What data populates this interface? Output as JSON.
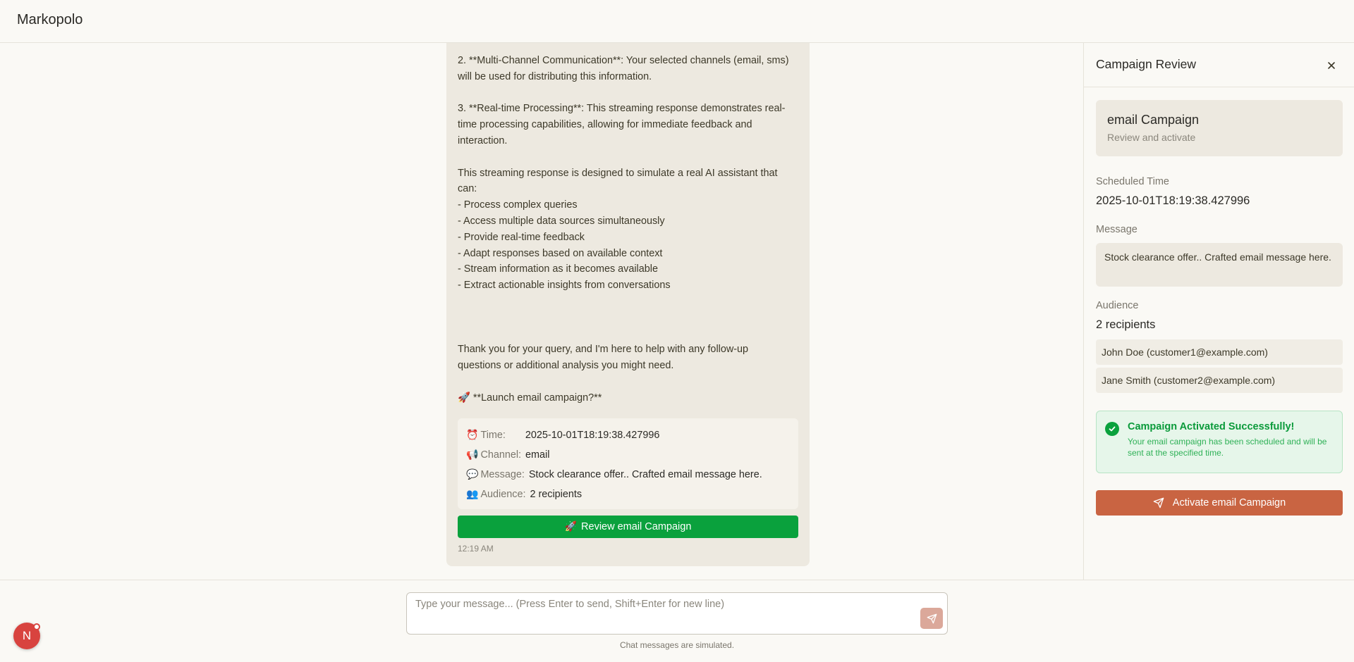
{
  "app": {
    "title": "Markopolo"
  },
  "chat": {
    "message_text": "2. **Multi-Channel Communication**: Your selected channels (email, sms)\nwill be used for distributing this information.\n\n3. **Real-time Processing**: This streaming response demonstrates real-\ntime processing capabilities, allowing for immediate feedback and\ninteraction.\n\nThis streaming response is designed to simulate a real AI assistant that\ncan:\n- Process complex queries\n- Access multiple data sources simultaneously\n- Provide real-time feedback\n- Adapt responses based on available context\n- Stream information as it becomes available\n- Extract actionable insights from conversations\n\n\n\nThank you for your query, and I'm here to help with any follow-up\nquestions or additional analysis you might need.\n\n🚀 **Launch email campaign?**",
    "details": {
      "time": {
        "icon": "⏰",
        "label": "Time:",
        "value": "2025-10-01T18:19:38.427996"
      },
      "channel": {
        "icon": "📢",
        "label": "Channel:",
        "value": "email"
      },
      "message": {
        "icon": "💬",
        "label": "Message:",
        "value": "Stock clearance offer.. Crafted email message here."
      },
      "audience": {
        "icon": "👥",
        "label": "Audience:",
        "value": "2 recipients"
      }
    },
    "review_button": {
      "icon": "🚀",
      "label": "Review email Campaign"
    },
    "timestamp": "12:19 AM"
  },
  "panel": {
    "title": "Campaign Review",
    "campaign_name": "email Campaign",
    "campaign_subtitle": "Review and activate",
    "scheduled_label": "Scheduled Time",
    "scheduled_value": "2025-10-01T18:19:38.427996",
    "message_label": "Message",
    "message_value": "Stock clearance offer.. Crafted email message here.",
    "audience_label": "Audience",
    "audience_count": "2 recipients",
    "recipients": [
      "John Doe (customer1@example.com)",
      "Jane Smith (customer2@example.com)"
    ],
    "success_title": "Campaign Activated Successfully!",
    "success_text": "Your email campaign has been scheduled and will be sent at the specified time.",
    "activate_label": "Activate email Campaign"
  },
  "footer": {
    "placeholder": "Type your message... (Press Enter to send, Shift+Enter for new line)",
    "disclaimer": "Chat messages are simulated."
  },
  "user": {
    "initial": "N"
  },
  "colors": {
    "accent": "#c96442",
    "success": "#0aa13d",
    "bubble": "#ede9e0",
    "background": "#faf9f5",
    "avatar": "#d8433f"
  }
}
